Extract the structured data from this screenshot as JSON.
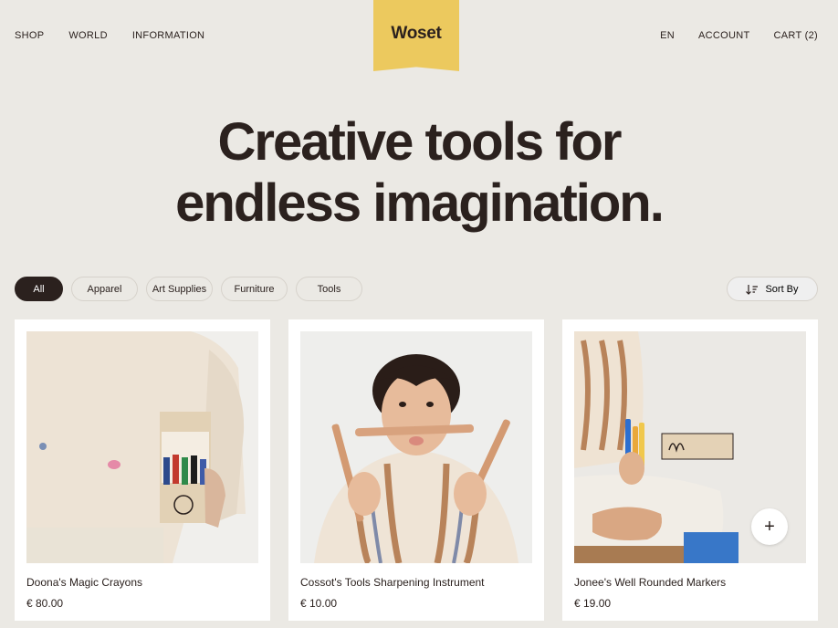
{
  "nav": {
    "left": [
      "SHOP",
      "WORLD",
      "INFORMATION"
    ],
    "right": [
      "EN",
      "ACCOUNT",
      "CART (2)"
    ]
  },
  "logo": "Woset",
  "hero": {
    "line1": "Creative tools for",
    "line2": "endless imagination."
  },
  "filters": [
    "All",
    "Apparel",
    "Art Supplies",
    "Furniture",
    "Tools"
  ],
  "active_filter": "All",
  "sort": {
    "label": "Sort By",
    "icon": "sort-icon"
  },
  "products": [
    {
      "name": "Doona's Magic Crayons",
      "price": "€ 80.00"
    },
    {
      "name": "Cossot's Tools Sharpening Instrument",
      "price": "€ 10.00"
    },
    {
      "name": "Jonee's Well Rounded Markers",
      "price": "€ 19.00"
    }
  ],
  "colors": {
    "background": "#ebe9e4",
    "logo": "#ecc95e",
    "text": "#2b211e",
    "card": "#ffffff"
  }
}
